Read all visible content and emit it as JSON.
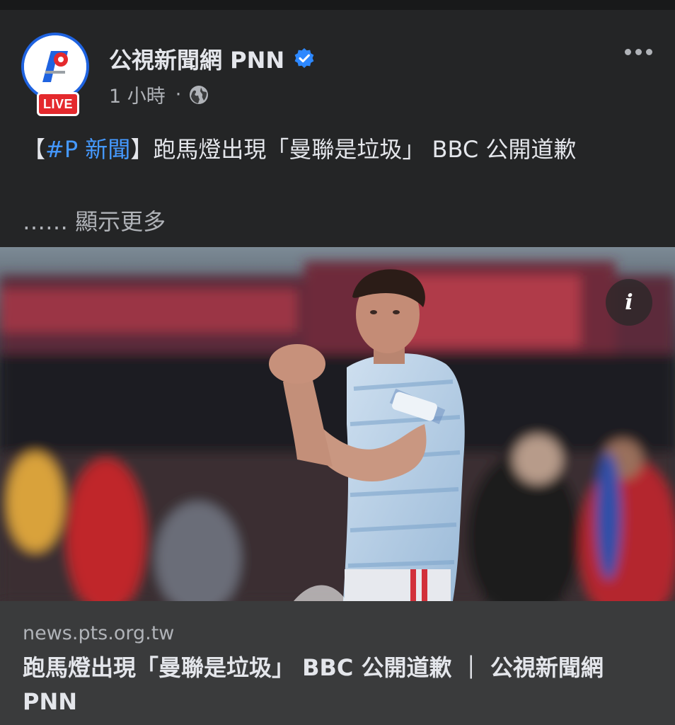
{
  "post": {
    "page_name": "公視新聞網 PNN",
    "live_badge": "LIVE",
    "time": "1 小時",
    "dot": "·",
    "icons": {
      "verified": "verified-badge-icon",
      "audience": "globe-icon",
      "more": "more-options-icon",
      "info": "info-icon"
    },
    "text": {
      "bracket_open": "【",
      "hashtag": "#P 新聞",
      "rest": "】跑馬燈出現「曼聯是垃圾」 BBC 公開道歉"
    },
    "ellipsis": "……",
    "see_more": "顯示更多",
    "info_glyph": "i"
  },
  "link_preview": {
    "domain": "news.pts.org.tw",
    "title": "跑馬燈出現「曼聯是垃圾」 BBC 公開道歉 ｜ 公視新聞網 PNN"
  },
  "colors": {
    "background": "#242526",
    "link_box": "#3a3b3c",
    "hashtag": "#4599ff",
    "live_red": "#e4292d",
    "brand_blue": "#1f63e0"
  }
}
